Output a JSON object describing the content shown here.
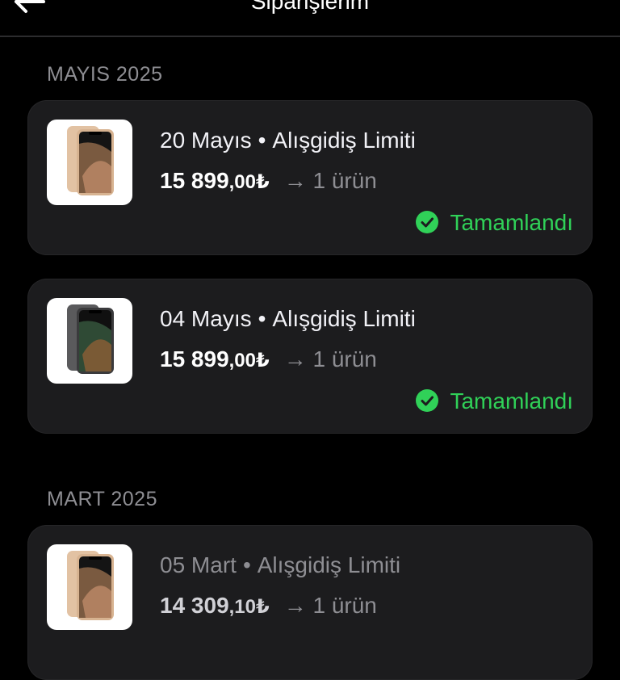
{
  "header": {
    "title": "Siparişlerim",
    "back_icon": "arrow-left-icon"
  },
  "sections": [
    {
      "label": "MAYIS 2025"
    },
    {
      "label": "MART 2025"
    }
  ],
  "orders": [
    {
      "date": "20 Mayıs",
      "type": "Alışgidiş Limiti",
      "price_main": "15 899",
      "price_decimal": ",00₺",
      "items": "→ 1 ürün",
      "status": "Tamamlandı",
      "phone_color": "gold"
    },
    {
      "date": "04 Mayıs",
      "type": "Alışgidiş Limiti",
      "price_main": "15 899",
      "price_decimal": ",00₺",
      "items": "→ 1 ürün",
      "status": "Tamamlandı",
      "phone_color": "space-gray"
    },
    {
      "date": "05 Mart",
      "type": "Alışgidiş Limiti",
      "price_main": "14 309",
      "price_decimal": ",10₺",
      "items": "→ 1 ürün",
      "phone_color": "gold"
    }
  ],
  "colors": {
    "background": "#000000",
    "card": "#1c1c1e",
    "status_green": "#30d158",
    "muted": "#8e8e93"
  },
  "separator": "•"
}
